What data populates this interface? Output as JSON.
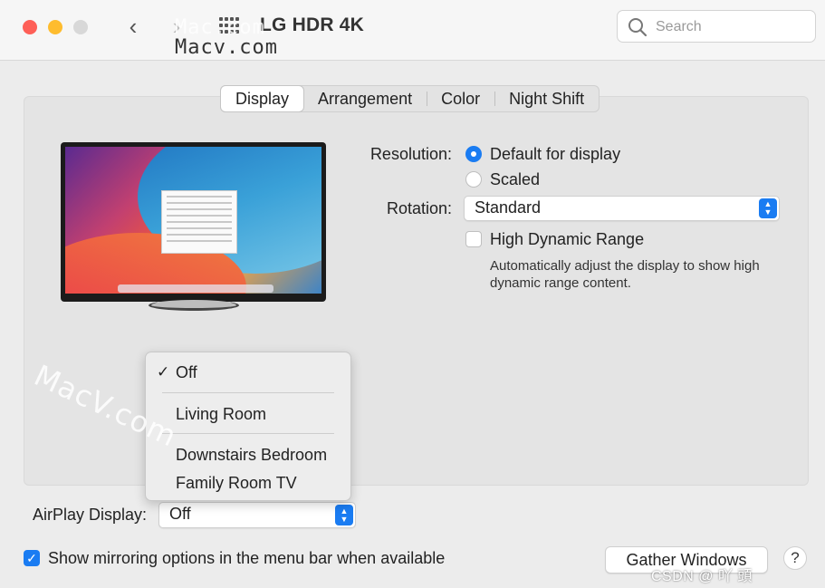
{
  "window": {
    "title": "LG HDR 4K",
    "search_placeholder": "Search"
  },
  "watermark": {
    "text_upper": "Mac.com",
    "text_lower": "Macv.com",
    "diagonal": "MacV.com",
    "corner": "CSDN @​​ 吖​ 頭​"
  },
  "tabs": [
    {
      "label": "Display",
      "active": true
    },
    {
      "label": "Arrangement",
      "active": false
    },
    {
      "label": "Color",
      "active": false
    },
    {
      "label": "Night Shift",
      "active": false
    }
  ],
  "resolution": {
    "label": "Resolution:",
    "options": [
      {
        "label": "Default for display",
        "selected": true
      },
      {
        "label": "Scaled",
        "selected": false
      }
    ]
  },
  "rotation": {
    "label": "Rotation:",
    "value": "Standard"
  },
  "hdr": {
    "label": "High Dynamic Range",
    "checked": false,
    "hint_line1": "Automatically adjust the display to show high",
    "hint_line2": "dynamic range content."
  },
  "airplay": {
    "label": "AirPlay Display:",
    "value": "Off",
    "menu": [
      {
        "label": "Off",
        "checked": true
      },
      {
        "label": "Living Room",
        "checked": false
      },
      {
        "label": "Downstairs Bedroom",
        "checked": false
      },
      {
        "label": "Family Room TV",
        "checked": false
      }
    ]
  },
  "mirroring": {
    "label": "Show mirroring options in the menu bar when available",
    "checked": true
  },
  "buttons": {
    "gather": "Gather Windows",
    "help": "?"
  },
  "colors": {
    "accent": "#1a7cf2",
    "close": "#fe5f57",
    "minimize": "#febc2e"
  }
}
